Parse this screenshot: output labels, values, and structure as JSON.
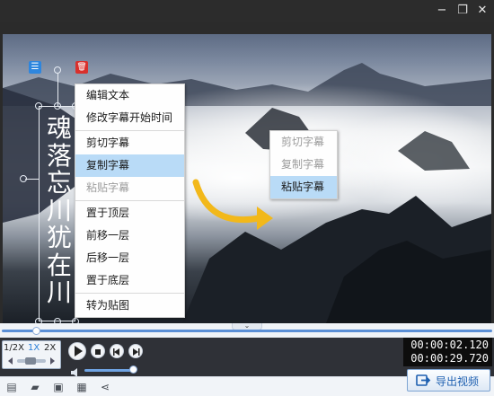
{
  "window": {
    "min_icon": "minimize-icon",
    "restore_icon": "restore-icon",
    "close_icon": "close-icon",
    "minimize_glyph": "−",
    "restore_glyph": "❐",
    "close_glyph": "✕"
  },
  "subtitle": {
    "text": "魂落忘川犹在川",
    "list_icon": "list-icon",
    "delete_icon": "delete-icon",
    "list_glyph": "☰",
    "delete_glyph": "🗑"
  },
  "context_menu": {
    "edit_text": "编辑文本",
    "change_start_time": "修改字幕开始时间",
    "cut": "剪切字幕",
    "copy": "复制字幕",
    "paste": "粘贴字幕",
    "bring_to_front": "置于顶层",
    "move_forward": "前移一层",
    "move_backward": "后移一层",
    "send_to_back": "置于底层",
    "convert_to_sticker": "转为贴图"
  },
  "secondary_menu": {
    "cut": "剪切字幕",
    "copy": "复制字幕",
    "paste": "粘贴字幕"
  },
  "playback": {
    "progress_fraction": 0.07,
    "speed_options": [
      "1/2X",
      "1X",
      "2X"
    ],
    "speed_selected": "1X",
    "volume_fraction": 0.95,
    "current_time": "00:00:02.120",
    "total_time": "00:00:29.720"
  },
  "toolbar": {
    "export_label": "导出视频",
    "export_icon": "export-video-icon"
  },
  "colors": {
    "accent": "#2b7fd8",
    "menu_highlight": "#b9dbf7",
    "arrow": "#f2b81a",
    "delete_red": "#d9302c",
    "list_blue": "#2e86de"
  }
}
